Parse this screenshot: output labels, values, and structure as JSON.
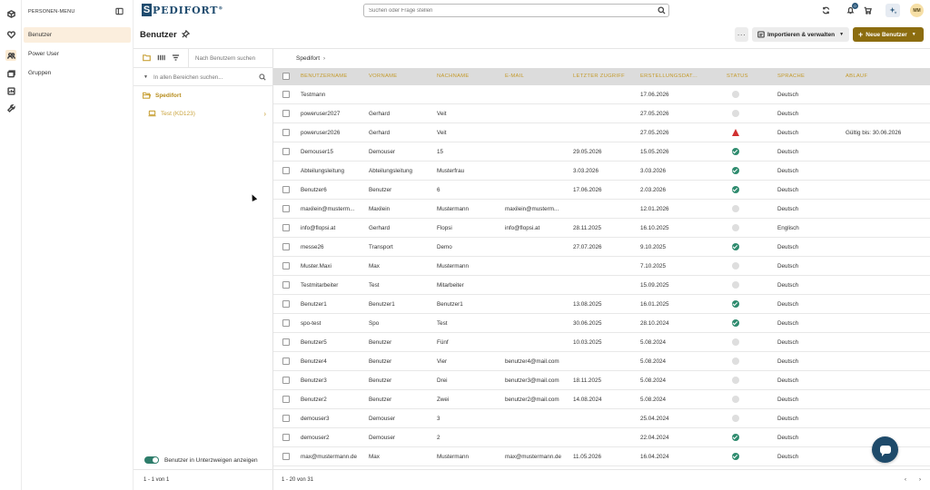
{
  "sidebar_rail": {
    "icons": [
      "box-icon",
      "heart-icon",
      "users-icon",
      "folders-icon",
      "report-icon",
      "tools-icon"
    ],
    "active_index": 2
  },
  "personen_menu": {
    "title": "PERSONEN-MENU",
    "items": [
      {
        "label": "Benutzer",
        "active": true
      },
      {
        "label": "Power User",
        "active": false
      },
      {
        "label": "Gruppen",
        "active": false
      }
    ]
  },
  "header": {
    "logo_mark": "S",
    "logo_text": "PEDIFORT",
    "logo_suffix": "®",
    "search_placeholder": "Suchen oder Frage stellen",
    "notification_count": "0",
    "avatar_initials": "MM"
  },
  "page": {
    "title": "Benutzer",
    "more_label": "···",
    "import_label": "Importieren & verwalten",
    "new_user_label": "Neue Benutzer",
    "accent_color": "#8c6d10"
  },
  "tree": {
    "user_search_placeholder": "Nach Benutzern suchen",
    "area_search_placeholder": "In allen Bereichen suchen...",
    "root_label": "Spedifort",
    "child_label": "Test (KD123)",
    "toggle_label": "Benutzer in Unterzweigen anzeigen",
    "toggle_on": true,
    "footer": "1 - 1 von 1"
  },
  "table": {
    "breadcrumb": "Spedifort",
    "columns": [
      "BENUTZERNAME",
      "VORNAME",
      "NACHNAME",
      "E-MAIL",
      "LETZTER ZUGRIFF",
      "ERSTELLUNGSDAT...",
      "STATUS",
      "SPRACHE",
      "ABLAUF"
    ],
    "rows": [
      {
        "username": "Testmann",
        "firstname": "",
        "lastname": "",
        "email": "",
        "last_access": "",
        "created": "17.06.2026",
        "status": "inactive",
        "language": "Deutsch",
        "expiry": ""
      },
      {
        "username": "poweruser2027",
        "firstname": "Gerhard",
        "lastname": "Veit",
        "email": "",
        "last_access": "",
        "created": "27.05.2026",
        "status": "inactive",
        "language": "Deutsch",
        "expiry": ""
      },
      {
        "username": "poweruser2026",
        "firstname": "Gerhard",
        "lastname": "Veit",
        "email": "",
        "last_access": "",
        "created": "27.05.2026",
        "status": "warn",
        "language": "Deutsch",
        "expiry": "Gültig bis: 30.06.2026"
      },
      {
        "username": "Demouser15",
        "firstname": "Demouser",
        "lastname": "15",
        "email": "",
        "last_access": "29.05.2026",
        "created": "15.05.2026",
        "status": "active",
        "language": "Deutsch",
        "expiry": ""
      },
      {
        "username": "Abteilungsleitung",
        "firstname": "Abteilungsleitung",
        "lastname": "Musterfrau",
        "email": "",
        "last_access": "3.03.2026",
        "created": "3.03.2026",
        "status": "active",
        "language": "Deutsch",
        "expiry": ""
      },
      {
        "username": "Benutzer6",
        "firstname": "Benutzer",
        "lastname": "6",
        "email": "",
        "last_access": "17.06.2026",
        "created": "2.03.2026",
        "status": "active",
        "language": "Deutsch",
        "expiry": ""
      },
      {
        "username": "maxilein@musterm...",
        "firstname": "Maxilein",
        "lastname": "Mustermann",
        "email": "maxilein@musterm...",
        "last_access": "",
        "created": "12.01.2026",
        "status": "inactive",
        "language": "Deutsch",
        "expiry": ""
      },
      {
        "username": "info@flopsi.at",
        "firstname": "Gerhard",
        "lastname": "Flopsi",
        "email": "info@flopsi.at",
        "last_access": "28.11.2025",
        "created": "16.10.2025",
        "status": "inactive",
        "language": "Englisch",
        "expiry": ""
      },
      {
        "username": "messe26",
        "firstname": "Transport",
        "lastname": "Demo",
        "email": "",
        "last_access": "27.07.2026",
        "created": "9.10.2025",
        "status": "active",
        "language": "Deutsch",
        "expiry": ""
      },
      {
        "username": "Muster.Maxi",
        "firstname": "Max",
        "lastname": "Mustermann",
        "email": "",
        "last_access": "",
        "created": "7.10.2025",
        "status": "inactive",
        "language": "Deutsch",
        "expiry": ""
      },
      {
        "username": "Testmitarbeiter",
        "firstname": "Test",
        "lastname": "Mitarbeiter",
        "email": "",
        "last_access": "",
        "created": "15.09.2025",
        "status": "inactive",
        "language": "Deutsch",
        "expiry": ""
      },
      {
        "username": "Benutzer1",
        "firstname": "Benutzer1",
        "lastname": "Benutzer1",
        "email": "",
        "last_access": "13.08.2025",
        "created": "16.01.2025",
        "status": "active",
        "language": "Deutsch",
        "expiry": ""
      },
      {
        "username": "spo-test",
        "firstname": "Spo",
        "lastname": "Test",
        "email": "",
        "last_access": "30.06.2025",
        "created": "28.10.2024",
        "status": "active",
        "language": "Deutsch",
        "expiry": ""
      },
      {
        "username": "Benutzer5",
        "firstname": "Benutzer",
        "lastname": "Fünf",
        "email": "",
        "last_access": "10.03.2025",
        "created": "5.08.2024",
        "status": "inactive",
        "language": "Deutsch",
        "expiry": ""
      },
      {
        "username": "Benutzer4",
        "firstname": "Benutzer",
        "lastname": "Vier",
        "email": "benutzer4@mail.com",
        "last_access": "",
        "created": "5.08.2024",
        "status": "inactive",
        "language": "Deutsch",
        "expiry": ""
      },
      {
        "username": "Benutzer3",
        "firstname": "Benutzer",
        "lastname": "Drei",
        "email": "benutzer3@mail.com",
        "last_access": "18.11.2025",
        "created": "5.08.2024",
        "status": "inactive",
        "language": "Deutsch",
        "expiry": ""
      },
      {
        "username": "Benutzer2",
        "firstname": "Benutzer",
        "lastname": "Zwei",
        "email": "benutzer2@mail.com",
        "last_access": "14.08.2024",
        "created": "5.08.2024",
        "status": "inactive",
        "language": "Deutsch",
        "expiry": ""
      },
      {
        "username": "demouser3",
        "firstname": "Demouser",
        "lastname": "3",
        "email": "",
        "last_access": "",
        "created": "25.04.2024",
        "status": "inactive",
        "language": "Deutsch",
        "expiry": ""
      },
      {
        "username": "demouser2",
        "firstname": "Demouser",
        "lastname": "2",
        "email": "",
        "last_access": "",
        "created": "22.04.2024",
        "status": "active",
        "language": "Deutsch",
        "expiry": ""
      },
      {
        "username": "max@mustermann.de",
        "firstname": "Max",
        "lastname": "Mustermann",
        "email": "max@mustermann.de",
        "last_access": "11.05.2026",
        "created": "16.04.2024",
        "status": "active",
        "language": "Deutsch",
        "expiry": ""
      }
    ],
    "footer": "1 - 20 von 31"
  }
}
